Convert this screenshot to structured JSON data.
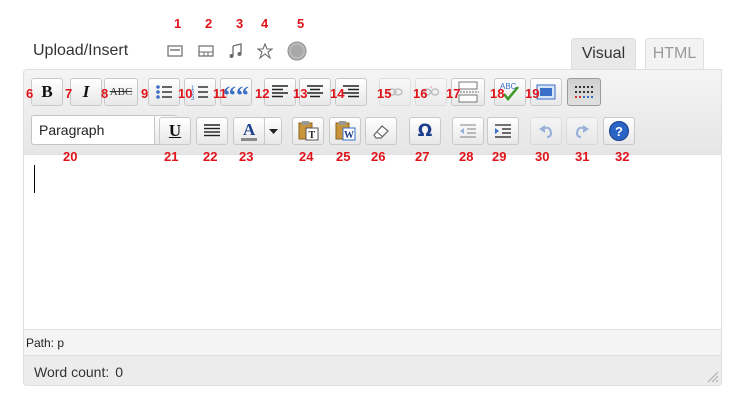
{
  "upload_insert_label": "Upload/Insert",
  "media_icons": [
    {
      "icon": "add-image-icon",
      "number": "1"
    },
    {
      "icon": "add-video-icon",
      "number": "2"
    },
    {
      "icon": "add-audio-icon",
      "number": "3"
    },
    {
      "icon": "add-media-icon",
      "number": "4"
    },
    {
      "icon": "add-poll-icon",
      "number": "5"
    }
  ],
  "tabs": {
    "visual": "Visual",
    "html": "HTML"
  },
  "toolbar_row1": [
    {
      "icon": "bold-icon",
      "glyph": "B",
      "number": "6"
    },
    {
      "icon": "italic-icon",
      "glyph": "I",
      "number": "7"
    },
    {
      "icon": "strikethrough-icon",
      "glyph": "ABC",
      "number": "8"
    },
    {
      "icon": "unordered-list-icon",
      "number": "9"
    },
    {
      "icon": "ordered-list-icon",
      "number": "10"
    },
    {
      "icon": "blockquote-icon",
      "glyph": "““",
      "number": "11"
    },
    {
      "icon": "align-left-icon",
      "number": "12"
    },
    {
      "icon": "align-center-icon",
      "number": "13"
    },
    {
      "icon": "align-right-icon",
      "number": "14"
    },
    {
      "icon": "insert-link-icon",
      "number": "15"
    },
    {
      "icon": "unlink-icon",
      "number": "16"
    },
    {
      "icon": "insert-more-icon",
      "number": "17"
    },
    {
      "icon": "spellcheck-icon",
      "glyph": "ABC",
      "number": "18"
    },
    {
      "icon": "fullscreen-icon",
      "number": "19"
    },
    {
      "icon": "kitchen-sink-icon",
      "number": ""
    }
  ],
  "format_select": {
    "value": "Paragraph"
  },
  "toolbar_row2": [
    {
      "icon": "underline-icon",
      "glyph": "U",
      "number": "21"
    },
    {
      "icon": "justify-icon",
      "number": "22"
    },
    {
      "icon": "text-color-icon",
      "glyph": "A",
      "number": "23"
    },
    {
      "icon": "paste-text-icon",
      "number": "24"
    },
    {
      "icon": "paste-word-icon",
      "number": "25"
    },
    {
      "icon": "remove-format-icon",
      "number": "26"
    },
    {
      "icon": "special-chars-icon",
      "glyph": "Ω",
      "number": "27"
    },
    {
      "icon": "outdent-icon",
      "number": "28"
    },
    {
      "icon": "indent-icon",
      "number": "29"
    },
    {
      "icon": "undo-icon",
      "number": "30"
    },
    {
      "icon": "redo-icon",
      "number": "31"
    },
    {
      "icon": "help-icon",
      "glyph": "?",
      "number": "32"
    }
  ],
  "format_select_number": "20",
  "path_text": "Path: p",
  "word_count": {
    "label": "Word count:",
    "value": "0"
  },
  "colors": {
    "annotation": "#e0131a",
    "text_color_bar": "#8a8a8a",
    "help_blue": "#2a64c5"
  }
}
